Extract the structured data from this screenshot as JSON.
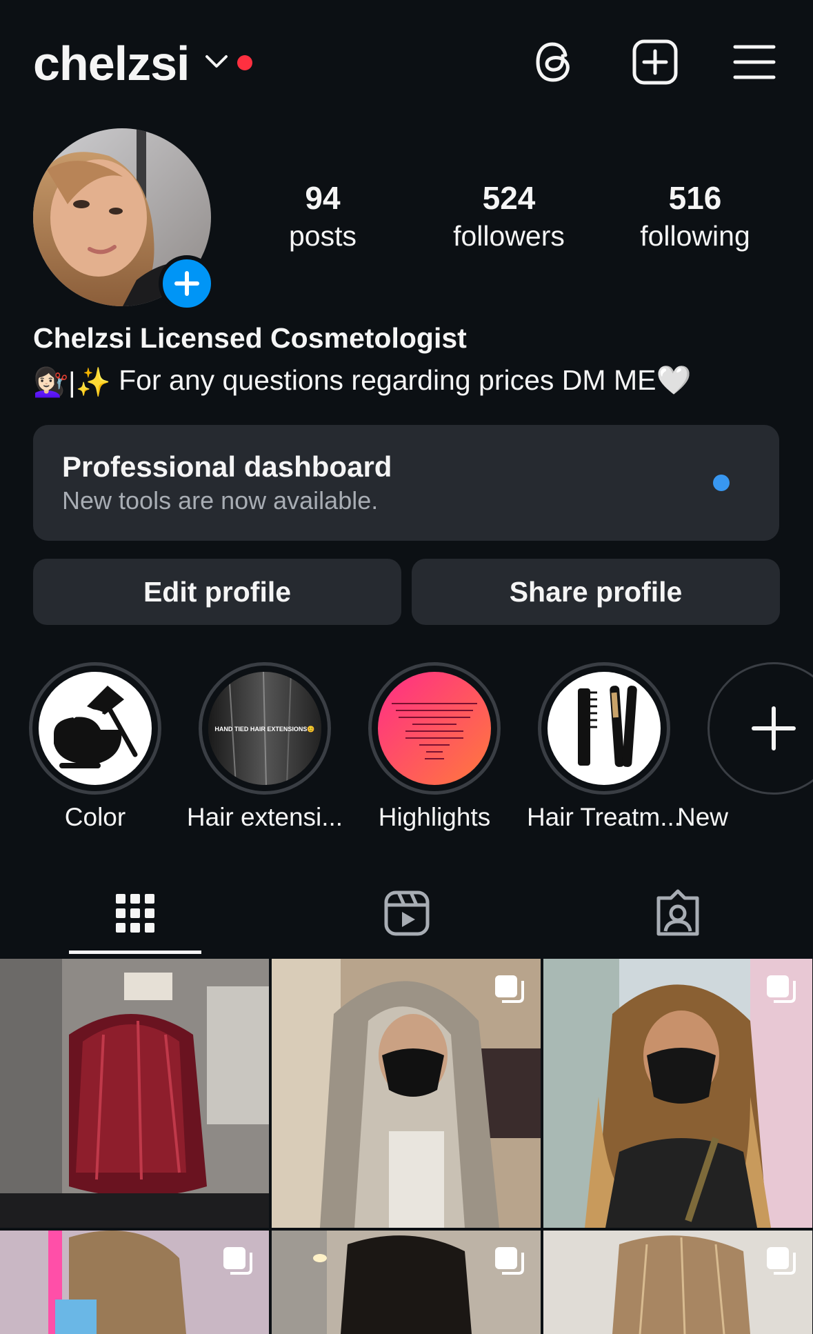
{
  "header": {
    "username": "chelzsi",
    "icons": [
      "threads-icon",
      "create-post-icon",
      "menu-icon"
    ]
  },
  "profile": {
    "stats": [
      {
        "value": "94",
        "label": "posts"
      },
      {
        "value": "524",
        "label": "followers"
      },
      {
        "value": "516",
        "label": "following"
      }
    ],
    "full_name": "Chelzsi Licensed Cosmetologist",
    "bio_prefix": "💇🏻‍♀️|✨",
    "bio_text": " For any questions regarding prices DM ME🤍"
  },
  "dashboard": {
    "title": "Professional dashboard",
    "subtitle": "New tools are now available."
  },
  "buttons": {
    "edit": "Edit profile",
    "share": "Share profile"
  },
  "highlights": [
    {
      "label": "Color",
      "icon": "hair-dye-bowl-icon"
    },
    {
      "label": "Hair extensi...",
      "icon": "hair-extensions-photo",
      "cover_text": "HAND TIED HAIR EXTENSIONS😊"
    },
    {
      "label": "Highlights",
      "icon": "highlights-flyer"
    },
    {
      "label": "Hair Treatm...",
      "icon": "comb-flat-iron-icon"
    },
    {
      "label": "New",
      "icon": "plus-icon"
    }
  ],
  "tabs": [
    "grid-icon",
    "reels-icon",
    "tagged-icon"
  ],
  "colors": {
    "background": "#0c1014",
    "surface": "#262a30",
    "accent_blue": "#0095f6",
    "notification_red": "#ff3040"
  }
}
